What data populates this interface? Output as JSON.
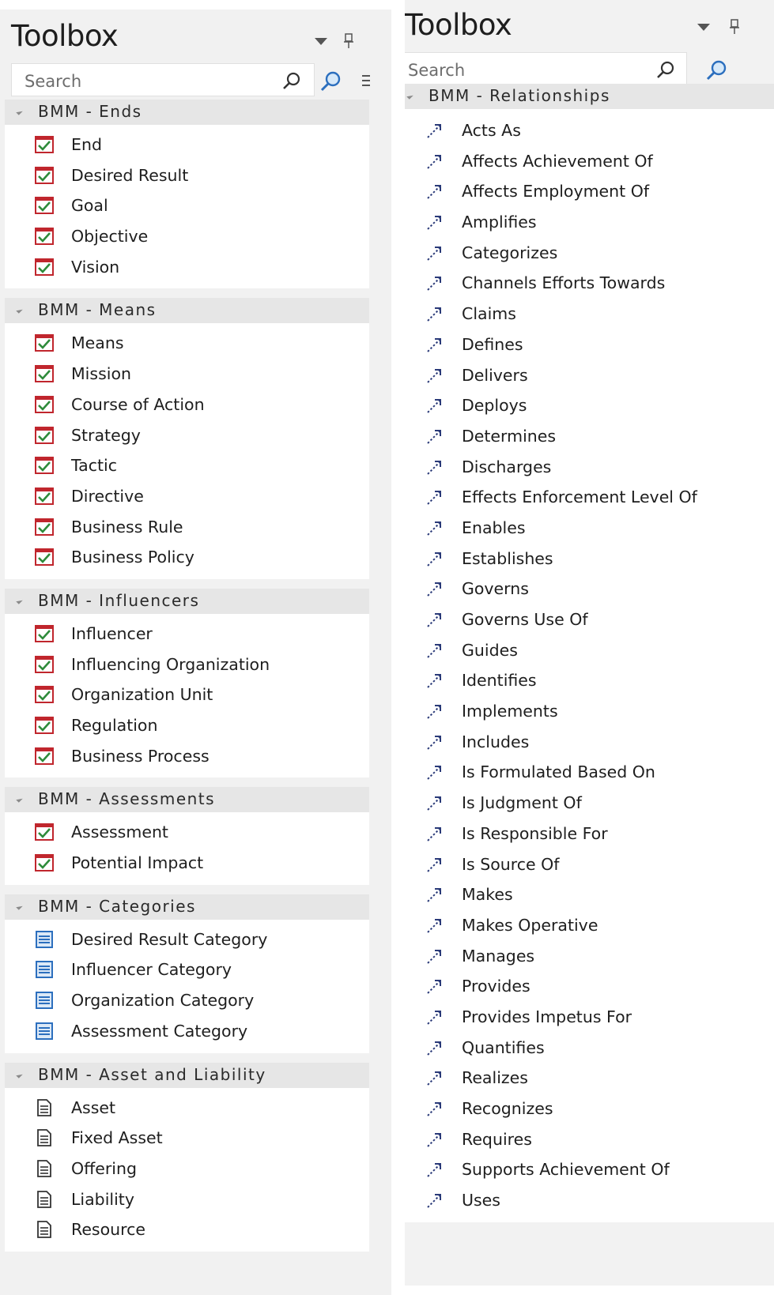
{
  "left_panel": {
    "title": "Toolbox",
    "search_placeholder": "Search",
    "sections": [
      {
        "label": "BMM - Ends",
        "icon": "checkbox-icon",
        "items": [
          "End",
          "Desired Result",
          "Goal",
          "Objective",
          "Vision"
        ]
      },
      {
        "label": "BMM - Means",
        "icon": "checkbox-icon",
        "items": [
          "Means",
          "Mission",
          "Course of Action",
          "Strategy",
          "Tactic",
          "Directive",
          "Business Rule",
          "Business Policy"
        ]
      },
      {
        "label": "BMM - Influencers",
        "icon": "checkbox-icon",
        "items": [
          "Influencer",
          "Influencing Organization",
          "Organization Unit",
          "Regulation",
          "Business Process"
        ]
      },
      {
        "label": "BMM - Assessments",
        "icon": "checkbox-icon",
        "items": [
          "Assessment",
          "Potential Impact"
        ]
      },
      {
        "label": "BMM - Categories",
        "icon": "category-list-icon",
        "items": [
          "Desired Result Category",
          "Influencer Category",
          "Organization Category",
          "Assessment Category"
        ]
      },
      {
        "label": "BMM - Asset and Liability",
        "icon": "document-icon",
        "items": [
          "Asset",
          "Fixed Asset",
          "Offering",
          "Liability",
          "Resource"
        ]
      }
    ]
  },
  "right_panel": {
    "title": "Toolbox",
    "search_placeholder": "Search",
    "sections": [
      {
        "label": "BMM - Relationships",
        "icon": "relationship-icon",
        "items": [
          "Acts As",
          "Affects Achievement Of",
          "Affects Employment Of",
          "Amplifies",
          "Categorizes",
          "Channels Efforts Towards",
          "Claims",
          "Defines",
          "Delivers",
          "Deploys",
          "Determines",
          "Discharges",
          "Effects Enforcement Level Of",
          "Enables",
          "Establishes",
          "Governs",
          "Governs Use Of",
          "Guides",
          "Identifies",
          "Implements",
          "Includes",
          "Is Formulated Based On",
          "Is Judgment Of",
          "Is Responsible For",
          "Is Source Of",
          "Makes",
          "Makes Operative",
          "Manages",
          "Provides",
          "Provides Impetus For",
          "Quantifies",
          "Realizes",
          "Recognizes",
          "Requires",
          "Supports Achievement Of",
          "Uses"
        ]
      }
    ]
  },
  "colors": {
    "panel_bg": "#f1f1f1",
    "section_bg": "#e6e6e6",
    "checkbox_red": "#c0262d",
    "checkbox_green": "#2e8b3a",
    "category_blue": "#2c6fbe",
    "relationship_navy": "#2a3a78"
  }
}
